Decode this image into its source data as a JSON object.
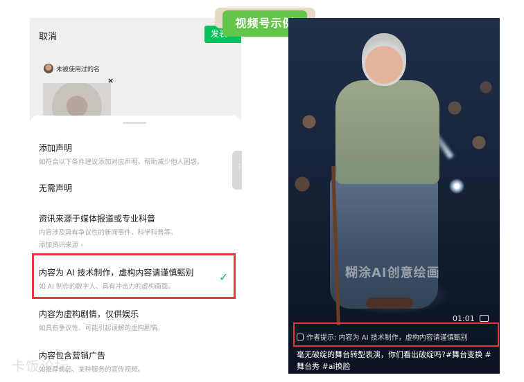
{
  "badge": {
    "label": "视频号示例"
  },
  "left": {
    "cancel": "取消",
    "publish": "发表",
    "name_hint": "未被使用过的名",
    "thumb_close": "×",
    "options": [
      {
        "title": "添加声明",
        "subtitle": "如符合以下条件建议添加对应声明，帮助减少他人困惑。"
      },
      {
        "title": "无需声明"
      },
      {
        "title": "资讯来源于媒体报道或专业科普",
        "subtitle": "内容涉及具有争议性的新闻事件、科学科普等。",
        "link": "添加资讯来源 ›"
      },
      {
        "title": "内容为 AI 技术制作，虚构内容请谨慎甄别",
        "subtitle": "如 AI 制作的数字人、具有冲击力的虚构画面。",
        "selected": true
      },
      {
        "title": "内容为虚构剧情，仅供娱乐",
        "subtitle": "如具有争议性、可能引起误解的虚构剧情。"
      },
      {
        "title": "内容包含营销广告",
        "subtitle": "如推荐商品、某种服务的宣传视频。"
      }
    ],
    "check": "✓"
  },
  "right": {
    "ai_watermark": "糊涂AI创意绘画",
    "duration": "01:01",
    "declaration": "作者提示: 内容为 AI 技术制作，虚构内容请谨慎甄别",
    "caption": "毫无破绽的舞台转型表演，你们看出破绽吗?#舞台变换 #舞台秀 #ai换脸"
  },
  "corner_watermark": "卡饭论坛",
  "colors": {
    "accent_green": "#07c160",
    "highlight_red": "#e53935",
    "badge_green": "#63c54a"
  }
}
